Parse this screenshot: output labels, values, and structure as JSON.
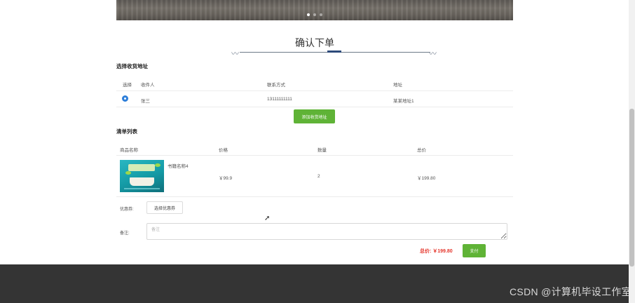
{
  "banner": {
    "slides": 3,
    "active_slide": 1
  },
  "page_title": "确认下单",
  "address": {
    "section_title": "选择收货地址",
    "headers": [
      "选择",
      "收件人",
      "联系方式",
      "地址"
    ],
    "rows": [
      {
        "name": "张三",
        "phone": "13111111111",
        "address": "某某地址1",
        "selected": true
      }
    ],
    "add_button": "添加收货地址"
  },
  "items": {
    "section_title": "清单列表",
    "headers": [
      "商品名称",
      "价格",
      "数量",
      "总价"
    ],
    "rows": [
      {
        "name": "书籍名称4",
        "price": "￥99.9",
        "qty": "2",
        "total": "￥199.80"
      }
    ]
  },
  "coupon": {
    "label": "优惠券:",
    "button": "选择优惠券"
  },
  "remark": {
    "label": "备注:",
    "placeholder": "备注"
  },
  "summary": {
    "total": "总价: ￥199.80",
    "pay_button": "支付"
  },
  "watermark": "CSDN @计算机毕设工作室",
  "colors": {
    "accent_green": "#5fb336",
    "price_red": "#e5352b",
    "footer": "#343434",
    "radio_blue": "#2e7fd9"
  }
}
